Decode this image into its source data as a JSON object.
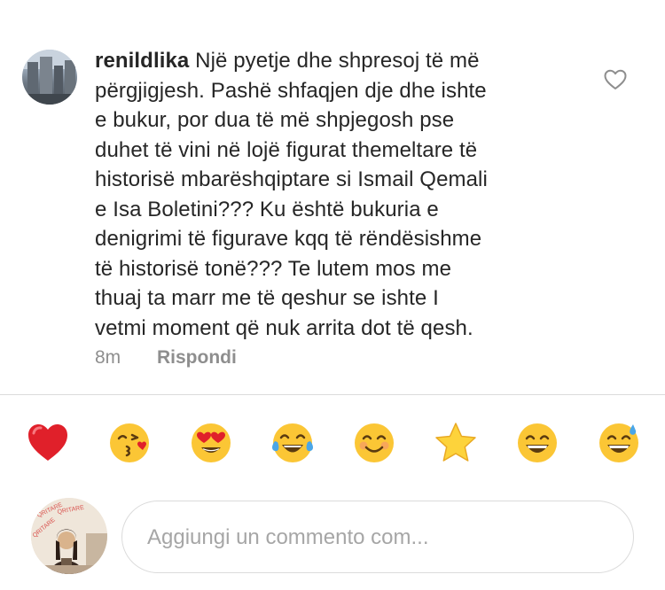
{
  "comment": {
    "username": "renildlika",
    "lines": [
      "Një pyetje dhe shpresoj të më",
      "përgjigjesh. Pashë shfaqjen dje dhe ishte",
      "e bukur, por dua të më shpjegosh pse",
      "duhet të vini në lojë figurat themeltare të",
      "historisë mbarëshqiptare si Ismail Qemali",
      "e Isa Boletini??? Ku është bukuria e",
      "denigrimi të figurave kqq të rëndësishme",
      "të historisë tonë??? Te lutem mos me",
      "thuaj ta marr me të qeshur se ishte I",
      "vetmi moment që nuk arrita dot të qesh."
    ],
    "time": "8m",
    "reply_label": "Rispondi"
  },
  "emoji_bar": [
    {
      "name": "red-heart",
      "glyph": "❤️"
    },
    {
      "name": "face-blowing-kiss",
      "glyph": "😘"
    },
    {
      "name": "heart-eyes",
      "glyph": "😍"
    },
    {
      "name": "tears-of-joy",
      "glyph": "😂"
    },
    {
      "name": "smiling-face",
      "glyph": "😊"
    },
    {
      "name": "star",
      "glyph": "⭐"
    },
    {
      "name": "grinning-face",
      "glyph": "😄"
    },
    {
      "name": "grinning-sweat",
      "glyph": "😅"
    }
  ],
  "composer": {
    "placeholder": "Aggiungi un commento com..."
  },
  "colors": {
    "text": "#262626",
    "muted": "#8e8e8e",
    "border": "#dbdbdb"
  }
}
